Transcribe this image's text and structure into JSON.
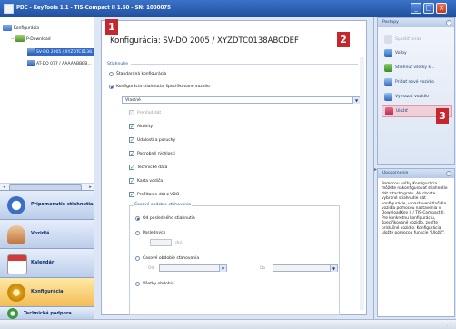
{
  "window": {
    "title": "PDC - KeyTools 1.1 - TIS-Compact II 1.50 - SN: 1000075",
    "min_glyph": "_",
    "max_glyph": "□",
    "close_glyph": "×"
  },
  "tree": {
    "items": [
      {
        "label": "Konfigurácia"
      },
      {
        "label": "P-Download"
      },
      {
        "label": "SV-DO 2005 / XYZDTC0138…"
      },
      {
        "label": "AT-DO 077 / AAAAABBBB…"
      }
    ]
  },
  "nav": {
    "items": [
      {
        "label": "Pripomenutie stiahnutia…"
      },
      {
        "label": "Vozidlá"
      },
      {
        "label": "Kalendár"
      },
      {
        "label": "Konfigurácia"
      },
      {
        "label": "Technická podpora"
      }
    ]
  },
  "main": {
    "title": "Konfigurácia: SV-DO 2005 / XYZDTC0138ABCDEF",
    "section_label": "Stiahnutie",
    "mode_options": [
      {
        "label": "Štandardná konfigurácia",
        "selected": false
      },
      {
        "label": "Konfigurácia stiahnutia, špecifikované vozidlo",
        "selected": true
      }
    ],
    "mode_select_value": "Vlastné",
    "data_checkboxes": [
      {
        "label": "Prehľad dát",
        "checked": false,
        "disabled": true
      },
      {
        "label": "Aktivity",
        "checked": true,
        "disabled": false
      },
      {
        "label": "Udalosti a poruchy",
        "checked": true,
        "disabled": false
      },
      {
        "label": "Podrobné rýchlosti",
        "checked": true,
        "disabled": false
      },
      {
        "label": "Technické dáta",
        "checked": true,
        "disabled": false
      },
      {
        "label": "Karta vodiča",
        "checked": true,
        "disabled": false
      },
      {
        "label": "Prečítanie dát z VDO",
        "checked": true,
        "disabled": false
      }
    ],
    "period_group_title": "Časové obdobie sťahovania",
    "period_options": [
      {
        "label": "Od posledného stiahnutia",
        "selected": true
      },
      {
        "label": "Posledných",
        "selected": false
      },
      {
        "label": "Časové obdobie sťahovania",
        "selected": false
      },
      {
        "label": "Všetky obdobia",
        "selected": false
      }
    ],
    "days_label": "dní",
    "from_label": "Od",
    "to_label": "Do"
  },
  "actions": {
    "header": "Postupy",
    "items": [
      {
        "label": "Spustiť teraz",
        "disabled": true
      },
      {
        "label": "Voľby",
        "disabled": false
      },
      {
        "label": "Stiahnuť všetky k…",
        "disabled": false
      },
      {
        "label": "Pridať nové vozidlo",
        "disabled": false
      },
      {
        "label": "Vymazať vozidlo",
        "disabled": false
      },
      {
        "label": "Uložiť",
        "disabled": false
      }
    ]
  },
  "note": {
    "header": "Upozornenie",
    "text": "Pomocou voľby Konfigurácia môžete nakonfigurovať stiahnutie dát z tachografu. Ak chcete vybrané stiahnutie dát konfigurácie, v nastavení tlačidla vozidla pomocou nastavenia v DownloadKey II / TIS-Compact II. Pre konkrétnu konfiguráciu, špecifikované vozidlo, zvoľte príslušné vozidlo. Konfigurácia uložte pomocou funkcie \"Uložiť\"."
  },
  "annotations": [
    "1",
    "2",
    "3"
  ],
  "colors": {
    "titlebar": "#2a5fb5",
    "badge": "#c4272d",
    "accent": "#2454a6",
    "active_nav": "#f3bd55",
    "selection": "#316ac5"
  }
}
